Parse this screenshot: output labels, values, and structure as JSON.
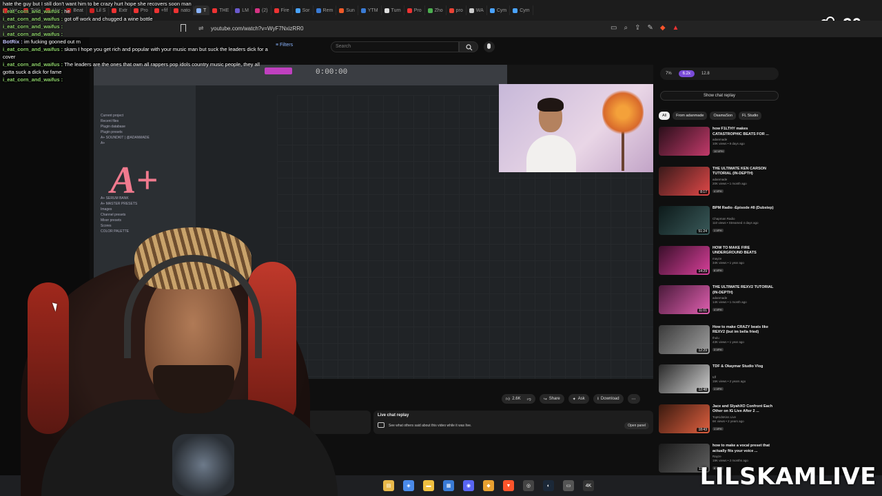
{
  "browser": {
    "tabs": [
      {
        "label": "Hor",
        "color": "#e33"
      },
      {
        "label": "Totti",
        "color": "#e33"
      },
      {
        "label": "Hor",
        "color": "#e33"
      },
      {
        "label": "Beat",
        "color": "#c22"
      },
      {
        "label": "Lil S",
        "color": "#c22"
      },
      {
        "label": "Extr",
        "color": "#e33"
      },
      {
        "label": "Pro",
        "color": "#e33"
      },
      {
        "label": "+fif",
        "color": "#e33"
      },
      {
        "label": "nato",
        "color": "#e33"
      },
      {
        "label": "T",
        "color": "#8ab4ff",
        "active": true
      },
      {
        "label": "THE",
        "color": "#e33"
      },
      {
        "label": "LM",
        "color": "#6a5acd"
      },
      {
        "label": "(2)",
        "color": "#d63384"
      },
      {
        "label": "Fire",
        "color": "#e33"
      },
      {
        "label": "Sor",
        "color": "#4aa3ff"
      },
      {
        "label": "Rem",
        "color": "#3a7bd5"
      },
      {
        "label": "Sun",
        "color": "#f05a28"
      },
      {
        "label": "YTM",
        "color": "#3a7bd5"
      },
      {
        "label": "Turn",
        "color": "#ddd"
      },
      {
        "label": "Pro",
        "color": "#e33"
      },
      {
        "label": "Zho",
        "color": "#4caf50"
      },
      {
        "label": "pro",
        "color": "#ea4335"
      },
      {
        "label": "WA",
        "color": "#ccc"
      },
      {
        "label": "Cym",
        "color": "#4aa3ff"
      },
      {
        "label": "Cym",
        "color": "#4aa3ff"
      }
    ],
    "url": "youtube.com/watch?v=WyF7NxizRR0"
  },
  "viewer_count": "90",
  "chat": [
    {
      "user": "",
      "text": "hate the guy but I still don't want him to be crazy hurt hope she recovers soon man"
    },
    {
      "user": "i_eat_corn_and_waifus :",
      "text": "he"
    },
    {
      "user": "i_eat_corn_and_waifus :",
      "text": "got off work and chugged a wine bottle"
    },
    {
      "user": "i_eat_corn_and_waifus :",
      "text": ""
    },
    {
      "user": "i_eat_corn_and_waifus :",
      "text": ""
    },
    {
      "user": "BotRix :",
      "text": "im fucking gooned out rn",
      "bot": true
    },
    {
      "user": "i_eat_corn_and_waifus :",
      "text": "skam I hope you get rich and popular with your music man but suck the leaders dick for a"
    },
    {
      "user": "",
      "text": "cover"
    },
    {
      "user": "i_eat_corn_and_waifus :",
      "text": "The leaders are the ones that own all rappers pop idols country music people, they all"
    },
    {
      "user": "",
      "text": "gotta suck a dick for fame"
    },
    {
      "user": "i_eat_corn_and_waifus :",
      "text": ""
    }
  ],
  "youtube": {
    "filters_label": "Filters",
    "search_placeholder": "Search",
    "daw_time": "0:00:00",
    "browser_items": [
      "Current project",
      "Recent files",
      "Plugin database",
      "Plugin presets",
      "A+ SOUNDKIT | @ADANMADE",
      "A+",
      "A+ SERUM BANK",
      "A+ MASTER PRESETS",
      "Images",
      "Channel presets",
      "Mixer presets",
      "Scores",
      "COLOR PALETTE"
    ],
    "logo_text": "A+",
    "actions": {
      "likes": "2.6K",
      "share": "Share",
      "ask": "Ask",
      "download": "Download"
    },
    "live_replay": {
      "title": "Live chat replay",
      "desc": "See what others said about this video while it was live.",
      "open": "Open panel"
    },
    "sidebar": {
      "pills": [
        "7%",
        "6.2x",
        "12.8"
      ],
      "show_chat": "Show chat replay",
      "chips": [
        "All",
        "From adanmade",
        "OsamaSon",
        "FL Studio"
      ],
      "recommendations": [
        {
          "title": "how F1LTHY makes CATASTROPHIC BEATS FOR ...",
          "channel": "adanmade",
          "meta": "10K views • 8 days ago",
          "badge": "10 VPH",
          "duration": "",
          "thumb": [
            "#2a0f1a",
            "#c23a6a"
          ]
        },
        {
          "title": "THE ULTIMATE KEN CARSON TUTORIAL (IN-DEPTH)",
          "channel": "adanmade",
          "meta": "20K views • 1 month ago",
          "badge": "4 VPH",
          "duration": "8:17",
          "thumb": [
            "#3a1a1a",
            "#e04848"
          ]
        },
        {
          "title": "BPM Radio -Episode #8 (Dubstep)",
          "channel": "Chapman Radio",
          "meta": "110 views • Streamed 4 days ago",
          "badge": "1 VPH",
          "duration": "51:24",
          "thumb": [
            "#0d1a1a",
            "#3a5a5a"
          ]
        },
        {
          "title": "HOW TO MAKE FIRE UNDERGROUND BEATS",
          "channel": "mayze",
          "meta": "34K views • 1 year ago",
          "badge": "8 VPH",
          "duration": "14:29",
          "thumb": [
            "#3a0f2a",
            "#d8409a"
          ]
        },
        {
          "title": "THE ULTIMATE REXV2 TUTORIAL (IN-DEPTH)",
          "channel": "adanmade",
          "meta": "14K views • 1 month ago",
          "badge": "4 VPH",
          "duration": "11:01",
          "thumb": [
            "#4a1a3a",
            "#e060b0"
          ]
        },
        {
          "title": "How to make CRAZY beats like REXV2 (but im bella fried)",
          "channel": "thulu",
          "meta": "43K views • 1 year ago",
          "badge": "3 VPH",
          "duration": "12:29",
          "thumb": [
            "#3a3a3a",
            "#a0a0a0"
          ]
        },
        {
          "title": "TDF & Okaymar Studio Vlog",
          "channel": "tdf",
          "meta": "15K views • 2 years ago",
          "badge": "1 VPH",
          "duration": "12:48",
          "thumb": [
            "#2a2a2a",
            "#d0d0d0"
          ]
        },
        {
          "title": "Jace and SlyahXO Confront Each Other on IG Live After 2 ...",
          "channel": "TopKidsKiss Live",
          "meta": "6K views • 2 years ago",
          "badge": "1 VPH",
          "duration": "18:43",
          "thumb": [
            "#3a1a0f",
            "#e06040"
          ]
        },
        {
          "title": "how to make a vocal preset that actually fits your voice ...",
          "channel": "Rayze",
          "meta": "19K views • 2 months ago",
          "badge": "8 VPH",
          "duration": "11:40",
          "thumb": [
            "#1a1a1a",
            "#606060"
          ]
        }
      ]
    }
  },
  "taskbar": {
    "icons": [
      {
        "name": "file-explorer-icon",
        "color": "#e8b84a",
        "glyph": "▤"
      },
      {
        "name": "copilot-icon",
        "color": "#4a8ae8",
        "glyph": "◈"
      },
      {
        "name": "folder-icon",
        "color": "#f0c040",
        "glyph": "▬"
      },
      {
        "name": "store-icon",
        "color": "#3a7bd5",
        "glyph": "▦"
      },
      {
        "name": "discord-icon",
        "color": "#5865f2",
        "glyph": "◉"
      },
      {
        "name": "winamp-icon",
        "color": "#e8a030",
        "glyph": "◆"
      },
      {
        "name": "brave-icon",
        "color": "#fb542b",
        "glyph": "▼"
      },
      {
        "name": "obs-icon",
        "color": "#444",
        "glyph": "◎"
      },
      {
        "name": "steam-icon",
        "color": "#1b2838",
        "glyph": "◐"
      },
      {
        "name": "app-icon",
        "color": "#555",
        "glyph": "▭"
      },
      {
        "name": "4k-icon",
        "color": "#333",
        "glyph": "4K"
      }
    ]
  },
  "watermark": "LILSKAMLIVE"
}
